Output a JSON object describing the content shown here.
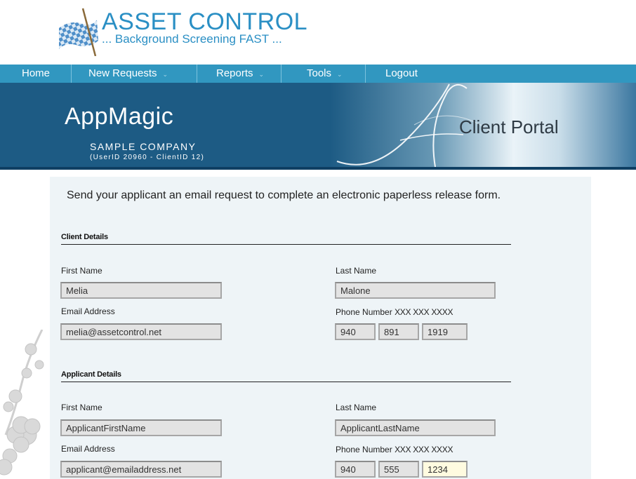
{
  "brand": {
    "title": "ASSET CONTROL",
    "subtitle": "... Background Screening FAST ..."
  },
  "nav": [
    {
      "label": "Home",
      "caret": false
    },
    {
      "label": "New Requests",
      "caret": true
    },
    {
      "label": "Reports",
      "caret": true
    },
    {
      "label": "Tools",
      "caret": true
    },
    {
      "label": "Logout",
      "caret": false
    }
  ],
  "banner": {
    "app_name": "AppMagic",
    "company": "SAMPLE COMPANY",
    "user_info": "(UserID 20960 - ClientID 12)",
    "portal": "Client Portal"
  },
  "intro": "Send your applicant an email request to complete an electronic paperless release form.",
  "client": {
    "section_title": "Client Details",
    "first_name_label": "First Name",
    "first_name": "Melia",
    "last_name_label": "Last Name",
    "last_name": "Malone",
    "email_label": "Email Address",
    "email": "melia@assetcontrol.net",
    "phone_label": "Phone Number",
    "phone_format": "XXX XXX XXXX",
    "phone_area": "940",
    "phone_prefix": "891",
    "phone_line": "1919"
  },
  "applicant": {
    "section_title": "Applicant Details",
    "first_name_label": "First Name",
    "first_name": "ApplicantFirstName",
    "last_name_label": "Last Name",
    "last_name": "ApplicantLastName",
    "email_label": "Email Address",
    "email": "applicant@emailaddress.net",
    "phone_label": "Phone Number",
    "phone_format": "XXX XXX XXXX",
    "phone_area": "940",
    "phone_prefix": "555",
    "phone_line": "1234"
  },
  "colors": {
    "nav": "#3197c0",
    "banner": "#1d5b84",
    "brand": "#2a8fc4",
    "content_bg": "#eef4f7",
    "active_field": "#fffbe0"
  }
}
